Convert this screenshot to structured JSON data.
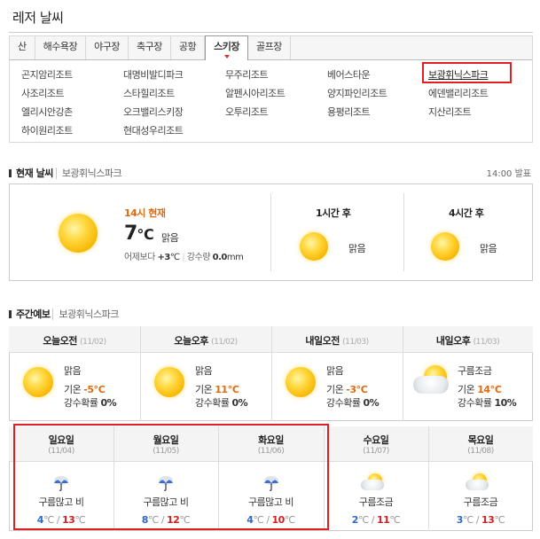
{
  "title": "레저 날씨",
  "tabs": [
    "산",
    "해수욕장",
    "야구장",
    "축구장",
    "공항",
    "스키장",
    "골프장"
  ],
  "active_tab": "스키장",
  "resorts": [
    [
      "곤지암리조트",
      "대명비발디파크",
      "무주리조트",
      "베어스타운",
      "보광휘닉스파크"
    ],
    [
      "사조리조트",
      "스타힐리조트",
      "알펜시아리조트",
      "양지파인리조트",
      "에덴밸리리조트"
    ],
    [
      "엘리시안강촌",
      "오크밸리스키장",
      "오투리조트",
      "용평리조트",
      "지산리조트"
    ],
    [
      "하이원리조트",
      "현대성우리조트"
    ]
  ],
  "current": {
    "section_title": "현재 날씨",
    "location": "보광휘닉스파크",
    "announce": "14:00 발표",
    "time_label": "14시 현재",
    "temp": "7",
    "unit": "℃",
    "condition": "맑음",
    "compare_label": "어제보다",
    "compare_value": "+3",
    "compare_unit": "℃",
    "rain_label": "강수량",
    "rain_value": "0.0",
    "rain_unit": "mm",
    "h1_label": "1시간 후",
    "h1_condition": "맑음",
    "h4_label": "4시간 후",
    "h4_condition": "맑음"
  },
  "weekly": {
    "section_title": "주간예보",
    "location": "보광휘닉스파크",
    "half_days": [
      {
        "label": "오늘오전",
        "date": "(11/02)",
        "condition": "맑음",
        "temp_label": "기온",
        "temp": "-5",
        "rain_label": "강수확률",
        "rain": "0%",
        "icon": "sun-icon"
      },
      {
        "label": "오늘오후",
        "date": "(11/02)",
        "condition": "맑음",
        "temp_label": "기온",
        "temp": "11",
        "rain_label": "강수확률",
        "rain": "0%",
        "icon": "sun-icon"
      },
      {
        "label": "내일오전",
        "date": "(11/03)",
        "condition": "맑음",
        "temp_label": "기온",
        "temp": "-3",
        "rain_label": "강수확률",
        "rain": "0%",
        "icon": "sun-icon"
      },
      {
        "label": "내일오후",
        "date": "(11/03)",
        "condition": "구름조금",
        "temp_label": "기온",
        "temp": "14",
        "rain_label": "강수확률",
        "rain": "10%",
        "icon": "sun-cloud-icon"
      }
    ],
    "days": [
      {
        "label": "일요일",
        "date": "(11/04)",
        "condition": "구름많고 비",
        "low": "4",
        "high": "13",
        "icon": "umbrella-icon"
      },
      {
        "label": "월요일",
        "date": "(11/05)",
        "condition": "구름많고 비",
        "low": "8",
        "high": "12",
        "icon": "umbrella-icon"
      },
      {
        "label": "화요일",
        "date": "(11/06)",
        "condition": "구름많고 비",
        "low": "4",
        "high": "10",
        "icon": "umbrella-icon"
      },
      {
        "label": "수요일",
        "date": "(11/07)",
        "condition": "구름조금",
        "low": "2",
        "high": "11",
        "icon": "sun-cloud-icon"
      },
      {
        "label": "목요일",
        "date": "(11/08)",
        "condition": "구름조금",
        "low": "3",
        "high": "13",
        "icon": "sun-cloud-icon"
      }
    ],
    "deg": "℃"
  },
  "colors": {
    "highlight": "#e02020",
    "orange": "#e06a10",
    "blue": "#2f68c8"
  }
}
